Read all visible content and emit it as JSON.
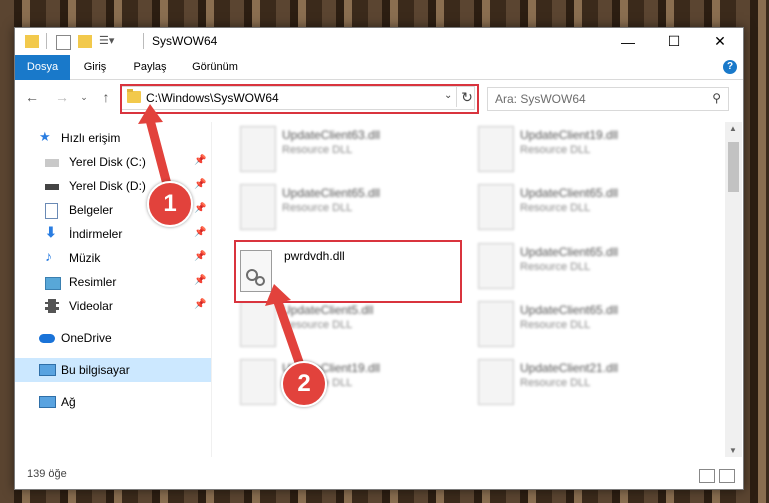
{
  "window": {
    "title": "SysWOW64",
    "controls": {
      "minimize": "—",
      "maximize": "☐",
      "close": "✕"
    }
  },
  "ribbon": {
    "tabs": [
      "Dosya",
      "Giriş",
      "Paylaş",
      "Görünüm"
    ],
    "help": "?"
  },
  "address_bar": {
    "path": "C:\\Windows\\SysWOW64",
    "dropdown": "⌄",
    "refresh": "↻"
  },
  "search": {
    "placeholder": "Ara: SysWOW64"
  },
  "sidebar": {
    "quick_access": "Hızlı erişim",
    "items": [
      {
        "label": "Yerel Disk (C:)",
        "icon": "drive-icon"
      },
      {
        "label": "Yerel Disk (D:)",
        "icon": "drive-icon"
      },
      {
        "label": "Belgeler",
        "icon": "documents-icon"
      },
      {
        "label": "İndirmeler",
        "icon": "download-icon"
      },
      {
        "label": "Müzik",
        "icon": "music-icon"
      },
      {
        "label": "Resimler",
        "icon": "pictures-icon"
      },
      {
        "label": "Videolar",
        "icon": "video-icon"
      }
    ],
    "onedrive": "OneDrive",
    "this_pc": "Bu bilgisayar",
    "network": "Ağ"
  },
  "files": {
    "left": [
      {
        "name": "UpdateClient63.dll",
        "type": "Resource DLL"
      },
      {
        "name": "UpdateClient65.dll",
        "type": "Resource DLL"
      },
      {
        "name": "UpdateClient5.dll",
        "type": "Resource DLL"
      },
      {
        "name": "UpdateClient19.dll",
        "type": "Resource DLL"
      }
    ],
    "right": [
      {
        "name": "UpdateClient19.dll",
        "type": "Resource DLL"
      },
      {
        "name": "UpdateClient65.dll",
        "type": "Resource DLL"
      },
      {
        "name": "UpdateClient65.dll",
        "type": "Resource DLL"
      },
      {
        "name": "UpdateClient65.dll",
        "type": "Resource DLL"
      },
      {
        "name": "UpdateClient21.dll",
        "type": "Resource DLL"
      }
    ],
    "featured": {
      "name": "pwrdvdh.dll"
    }
  },
  "status": {
    "count": "139 öğe"
  },
  "callouts": [
    "1",
    "2"
  ],
  "colors": {
    "accent": "#1979ca",
    "highlight": "#d9343e",
    "selection": "#cce8ff"
  }
}
